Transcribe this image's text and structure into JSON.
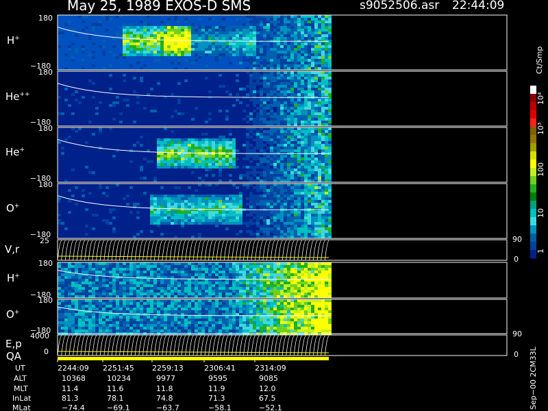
{
  "header": {
    "title": "May 25, 1989   EXOS-D SMS",
    "file": "s9052506.asr",
    "time": "22:44:09"
  },
  "panels": [
    {
      "id": "h",
      "label": "H",
      "sup": "+",
      "ymax": "180",
      "ymin": "−180"
    },
    {
      "id": "he2",
      "label": "He",
      "sup": "++",
      "ymax": "180",
      "ymin": "−180"
    },
    {
      "id": "he1",
      "label": "He",
      "sup": "+",
      "ymax": "180",
      "ymin": "−180"
    },
    {
      "id": "o",
      "label": "O",
      "sup": "+",
      "ymax": "180",
      "ymin": "−180"
    },
    {
      "id": "vr",
      "label": "V,r",
      "sup": "",
      "ymax": "25",
      "ymin": "",
      "rmax": "90",
      "rmin": "0"
    },
    {
      "id": "h2",
      "label": "H",
      "sup": "+",
      "ymax": "180",
      "ymin": "−180"
    },
    {
      "id": "o2",
      "label": "O",
      "sup": "+",
      "ymax": "180",
      "ymin": "−180"
    },
    {
      "id": "ep",
      "label": "E,p",
      "sup": "",
      "ymax": "4000",
      "ymin": "0",
      "rmax": "90",
      "rmin": "0"
    }
  ],
  "qa_label": "QA",
  "colorbar": {
    "unit": "Ct/Smp",
    "ticks": [
      "10⁴",
      "10³",
      "100",
      "10",
      "1"
    ],
    "colors": [
      "#ffffff",
      "#8b0000",
      "#c00000",
      "#e00000",
      "#ff2020",
      "#806000",
      "#907800",
      "#a0a000",
      "#d8e000",
      "#ffff00",
      "#c0f020",
      "#70d020",
      "#20b020",
      "#008000",
      "#00a080",
      "#00c0c0",
      "#40d8e0",
      "#0090c0",
      "#0060a0",
      "#0040a0",
      "#00208a"
    ]
  },
  "chart_data": {
    "type": "heatmap",
    "title": "May 25, 1989   EXOS-D SMS",
    "xlabel": "UT",
    "x_ticks": [
      "2244:09",
      "2251:45",
      "2259:13",
      "2306:41",
      "2314:09"
    ],
    "colorbar_label": "Ct/Smp",
    "colorbar_range": [
      1,
      10000
    ],
    "panels": [
      "H+",
      "He++",
      "He+",
      "O+",
      "V,r",
      "H+",
      "O+",
      "E,p"
    ],
    "ylim_pitch": [
      -180,
      180
    ],
    "ephemeris": {
      "rows": [
        {
          "name": "UT",
          "values": [
            "2244:09",
            "2251:45",
            "2259:13",
            "2306:41",
            "2314:09"
          ]
        },
        {
          "name": "ALT",
          "values": [
            "10368",
            "10234",
            "9977",
            "9595",
            "9085"
          ]
        },
        {
          "name": "MLT",
          "values": [
            "11.4",
            "11.6",
            "11.8",
            "11.9",
            "12.0"
          ]
        },
        {
          "name": "InLat",
          "values": [
            "81.3",
            "78.1",
            "74.8",
            "71.3",
            "67.5"
          ]
        },
        {
          "name": "MLat",
          "values": [
            "−74.4",
            "−69.1",
            "−63.7",
            "−58.1",
            "−52.1"
          ]
        }
      ]
    }
  },
  "footer_stamp": "Sep−00 2CM33L"
}
